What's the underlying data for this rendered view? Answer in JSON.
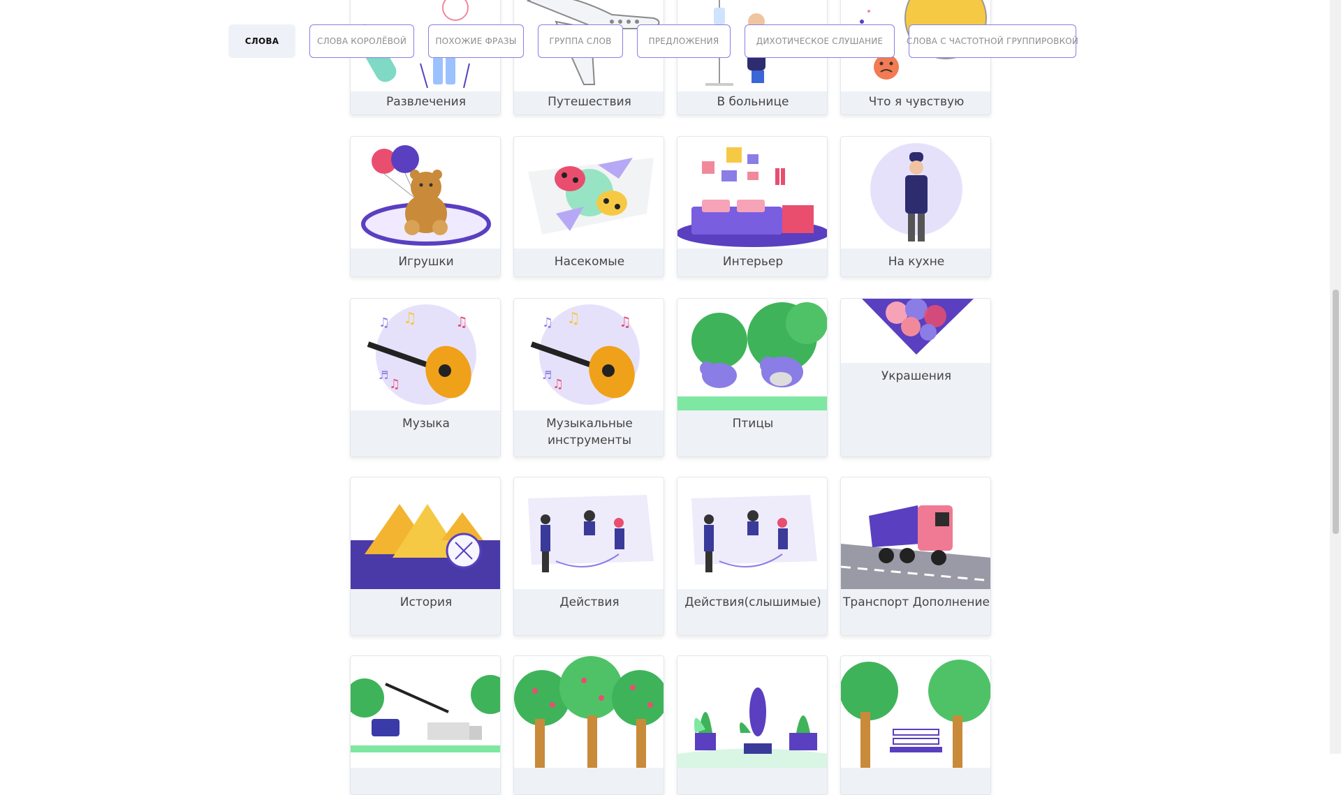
{
  "tabs": [
    {
      "label": "СЛОВА",
      "active": true
    },
    {
      "label": "СЛОВА КОРОЛЁВОЙ",
      "active": false
    },
    {
      "label": "ПОХОЖИЕ ФРАЗЫ",
      "active": false
    },
    {
      "label": "ГРУППА СЛОВ",
      "active": false
    },
    {
      "label": "ПРЕДЛОЖЕНИЯ",
      "active": false
    },
    {
      "label": "ДИХОТИЧЕСКОЕ СЛУШАНИЕ",
      "active": false
    },
    {
      "label": "СЛОВА С ЧАСТОТНОЙ ГРУППИРОВКОЙ",
      "active": false
    }
  ],
  "categories": [
    {
      "label": "Развлечения",
      "icon": "entertainment-icon"
    },
    {
      "label": "Путешествия",
      "icon": "airplane-icon"
    },
    {
      "label": "В больнице",
      "icon": "hospital-icon"
    },
    {
      "label": "Что я чувствую",
      "icon": "emotions-icon"
    },
    {
      "label": "Игрушки",
      "icon": "teddy-bear-icon"
    },
    {
      "label": "Насекомые",
      "icon": "ladybug-icon"
    },
    {
      "label": "Интерьер",
      "icon": "bedroom-icon"
    },
    {
      "label": "На кухне",
      "icon": "chef-icon"
    },
    {
      "label": "Музыка",
      "icon": "guitar-icon"
    },
    {
      "label": "Музыкальные инструменты",
      "icon": "guitar-icon"
    },
    {
      "label": "Птицы",
      "icon": "birds-icon"
    },
    {
      "label": "Украшения",
      "icon": "flowers-icon"
    },
    {
      "label": "История",
      "icon": "pyramids-icon"
    },
    {
      "label": "Действия",
      "icon": "people-actions-icon"
    },
    {
      "label": "Действия(слышимые)",
      "icon": "people-actions-icon"
    },
    {
      "label": "Транспорт Дополнение",
      "icon": "dump-truck-icon"
    },
    {
      "label": "",
      "icon": "tow-truck-icon"
    },
    {
      "label": "",
      "icon": "apple-trees-icon"
    },
    {
      "label": "",
      "icon": "house-plants-icon"
    },
    {
      "label": "",
      "icon": "park-bench-icon"
    }
  ],
  "colors": {
    "accent": "#8a7de6",
    "purple": "#5a3fc0",
    "card_bg": "#eef2f7"
  }
}
